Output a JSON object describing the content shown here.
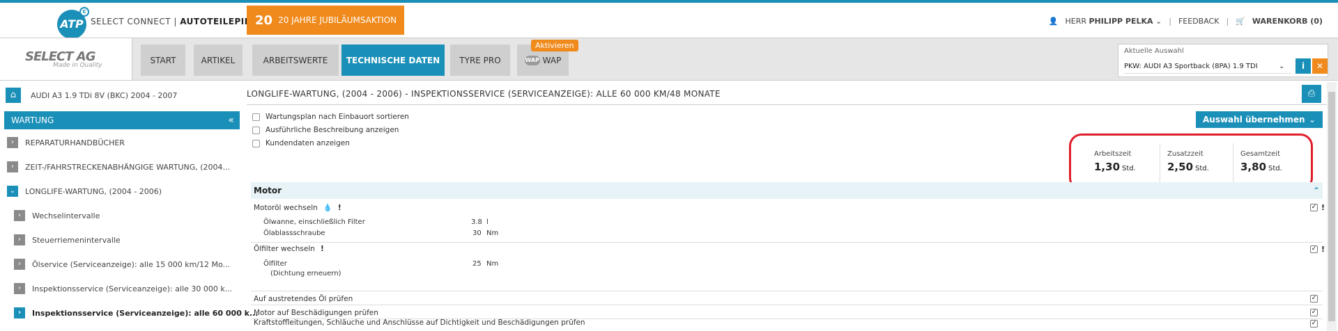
{
  "header": {
    "logo_text": "ATP",
    "brand_prefix": "SELECT CONNECT",
    "brand_name": "AUTOTEILEPILOT",
    "promo_icon": "20",
    "promo_label": "20 JAHRE JUBILÄUMSAKTION",
    "user_prefix": "HERR",
    "user_name": "PHILIPP PELKA",
    "feedback": "FEEDBACK",
    "cart": "WARENKORB (0)"
  },
  "nav": {
    "brand_name": "SELECT AG",
    "brand_tagline": "Made in Quality",
    "tabs": [
      {
        "label": "START"
      },
      {
        "label": "ARTIKEL"
      },
      {
        "label": "ARBEITSWERTE"
      },
      {
        "label": "TECHNISCHE DATEN"
      },
      {
        "label": "TYRE PRO"
      },
      {
        "label": "WAP"
      }
    ],
    "wap_logo": "WAP",
    "activate_badge": "Aktivieren",
    "selection_label": "Aktuelle Auswahl",
    "selection_value": "PKW: AUDI A3 Sportback (8PA) 1.9 TDI",
    "info_btn": "i",
    "close_btn": "✕"
  },
  "sidebar": {
    "vehicle": "AUDI A3 1.9 TDi 8V (BKC) 2004 - 2007",
    "section_title": "WARTUNG",
    "collapse_glyph": "«",
    "items": [
      {
        "label": "REPARATURHANDBÜCHER"
      },
      {
        "label": "ZEIT-/FAHRSTRECKENABHÄNGIGE WARTUNG, (2004..."
      },
      {
        "label": "LONGLIFE-WARTUNG, (2004 - 2006)"
      },
      {
        "label": "Wechselintervalle"
      },
      {
        "label": "Steuerriemenintervalle"
      },
      {
        "label": "Ölservice (Serviceanzeige): alle 15 000 km/12 Mo..."
      },
      {
        "label": "Inspektionsservice (Serviceanzeige): alle 30 000 k..."
      },
      {
        "label": "Inspektionsservice (Serviceanzeige): alle 60 000 k..."
      }
    ]
  },
  "main": {
    "title": "LONGLIFE-WARTUNG, (2004 - 2006) - INSPEKTIONSSERVICE (SERVICEANZEIGE): ALLE 60 000 KM/48 MONATE",
    "options": [
      {
        "label": "Wartungsplan nach Einbauort sortieren"
      },
      {
        "label": "Ausführliche Beschreibung anzeigen"
      },
      {
        "label": "Kundendaten anzeigen"
      }
    ],
    "apply_label": "Auswahl übernehmen",
    "times": [
      {
        "label": "Arbeitszeit",
        "value": "1,30",
        "unit": "Std."
      },
      {
        "label": "Zusatzzeit",
        "value": "2,50",
        "unit": "Std."
      },
      {
        "label": "Gesamtzeit",
        "value": "3,80",
        "unit": "Std."
      }
    ],
    "section": "Motor",
    "tasks": [
      {
        "label": "Motoröl wechseln"
      },
      {
        "label": "Ölfilter wechseln"
      },
      {
        "label": "Auf austretendes Öl prüfen"
      },
      {
        "label": "Motor auf Beschädigungen prüfen"
      },
      {
        "label": "Kraftstoffleitungen, Schläuche und Anschlüsse auf Dichtigkeit und Beschädigungen prüfen"
      }
    ],
    "details": {
      "oel_wanne": "Ölwanne, einschließlich Filter",
      "oel_wanne_val": "3.8",
      "oel_wanne_unit": "l",
      "ablass": "Ölablassschraube",
      "ablass_val": "30",
      "ablass_unit": "Nm",
      "filter": "Ölfilter",
      "filter_note": "(Dichtung erneuern)",
      "filter_val": "25",
      "filter_unit": "Nm"
    }
  },
  "colors": {
    "primary": "#1a8fb8",
    "accent": "#f08a1c",
    "highlight": "#e01e2a"
  }
}
